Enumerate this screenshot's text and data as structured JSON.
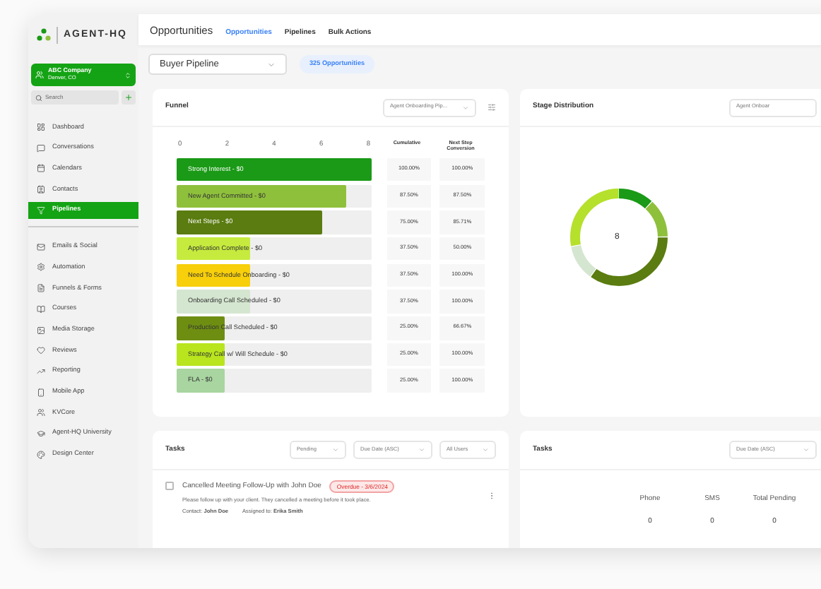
{
  "sidebar": {
    "logo": "AGENT-HQ",
    "company": {
      "name": "ABC Company",
      "location": "Denver, CO"
    },
    "search": {
      "placeholder": "Search"
    },
    "groups": [
      [
        {
          "label": "Dashboard",
          "selected": false
        },
        {
          "label": "Conversations",
          "selected": false
        },
        {
          "label": "Calendars",
          "selected": false
        },
        {
          "label": "Contacts",
          "selected": false
        },
        {
          "label": "Pipelines",
          "selected": true
        }
      ],
      [
        {
          "label": "Emails & Social",
          "selected": false
        },
        {
          "label": "Automation",
          "selected": false
        },
        {
          "label": "Funnels & Forms",
          "selected": false
        },
        {
          "label": "Courses",
          "selected": false
        },
        {
          "label": "Media Storage",
          "selected": false
        },
        {
          "label": "Reviews",
          "selected": false
        },
        {
          "label": "Reporting",
          "selected": false
        },
        {
          "label": "Mobile App",
          "selected": false
        },
        {
          "label": "KVCore",
          "selected": false
        },
        {
          "label": "Agent-HQ University",
          "selected": false
        },
        {
          "label": "Design Center",
          "selected": false
        }
      ]
    ]
  },
  "header": {
    "title": "Opportunities",
    "tabs": [
      {
        "label": "Opportunities",
        "selected": true
      },
      {
        "label": "Pipelines",
        "selected": false
      },
      {
        "label": "Bulk Actions",
        "selected": false
      }
    ]
  },
  "pipeline_select": {
    "value": "Buyer Pipeline"
  },
  "opportunity_count": "325 Opportunities",
  "funnel": {
    "title": "Funnel",
    "filter": "Agent Onboarding Pip...",
    "axis_ticks": [
      "0",
      "2",
      "4",
      "6",
      "8"
    ],
    "columns": [
      "Cumulative",
      "Next Step Conversion"
    ],
    "stages": [
      {
        "label": "Strong Interest - $0",
        "level": 1,
        "color": "#1a9a16",
        "cumulative": "100.00%",
        "next_step": "100.00%"
      },
      {
        "label": "New Agent Committed - $0",
        "level": 0.875,
        "color": "#8fc03c",
        "cumulative": "87.50%",
        "next_step": "87.50%"
      },
      {
        "label": "Next Steps - $0",
        "level": 0.75,
        "color": "#5a7c10",
        "cumulative": "75.00%",
        "next_step": "85.71%"
      },
      {
        "label": "Application Complete - $0",
        "level": 0.375,
        "color": "#c6eb3e",
        "cumulative": "37.50%",
        "next_step": "50.00%"
      },
      {
        "label": "Need To Schedule Onboarding - $0",
        "level": 0.375,
        "color": "#f7cf0a",
        "cumulative": "37.50%",
        "next_step": "100.00%"
      },
      {
        "label": "Onboarding Call Scheduled - $0",
        "level": 0.375,
        "color": "#d5e6d0",
        "cumulative": "37.50%",
        "next_step": "100.00%"
      },
      {
        "label": "Production Call Scheduled - $0",
        "level": 0.25,
        "color": "#6e8e12",
        "cumulative": "25.00%",
        "next_step": "66.67%"
      },
      {
        "label": "Strategy Call w/ Will Schedule - $0",
        "level": 0.25,
        "color": "#b8e51d",
        "cumulative": "25.00%",
        "next_step": "100.00%"
      },
      {
        "label": "FLA - $0",
        "level": 0.25,
        "color": "#a8d5a0",
        "cumulative": "25.00%",
        "next_step": "100.00%"
      }
    ]
  },
  "stage_distribution": {
    "title": "Stage Distribution",
    "filter": "Agent Onboar",
    "total": "8"
  },
  "tasks": {
    "title": "Tasks",
    "filters": [
      "Pending",
      "Due Date (ASC)",
      "All Users"
    ],
    "items": [
      {
        "checked": false,
        "title": "Cancelled Meeting Follow-Up with John Doe",
        "badge": "Overdue - 3/6/2024",
        "description": "Please follow up with your client. They cancelled a meeting before it took place.",
        "contact": "Contact: **John Doe**",
        "assignee": "Assigned to: **Erika Smith**"
      }
    ]
  },
  "task_summary": {
    "title": "Tasks",
    "filter": "Due Date (ASC)",
    "columns": [
      "Phone",
      "SMS",
      "Total Pending"
    ],
    "values": [
      "0",
      "0",
      "0"
    ]
  }
}
